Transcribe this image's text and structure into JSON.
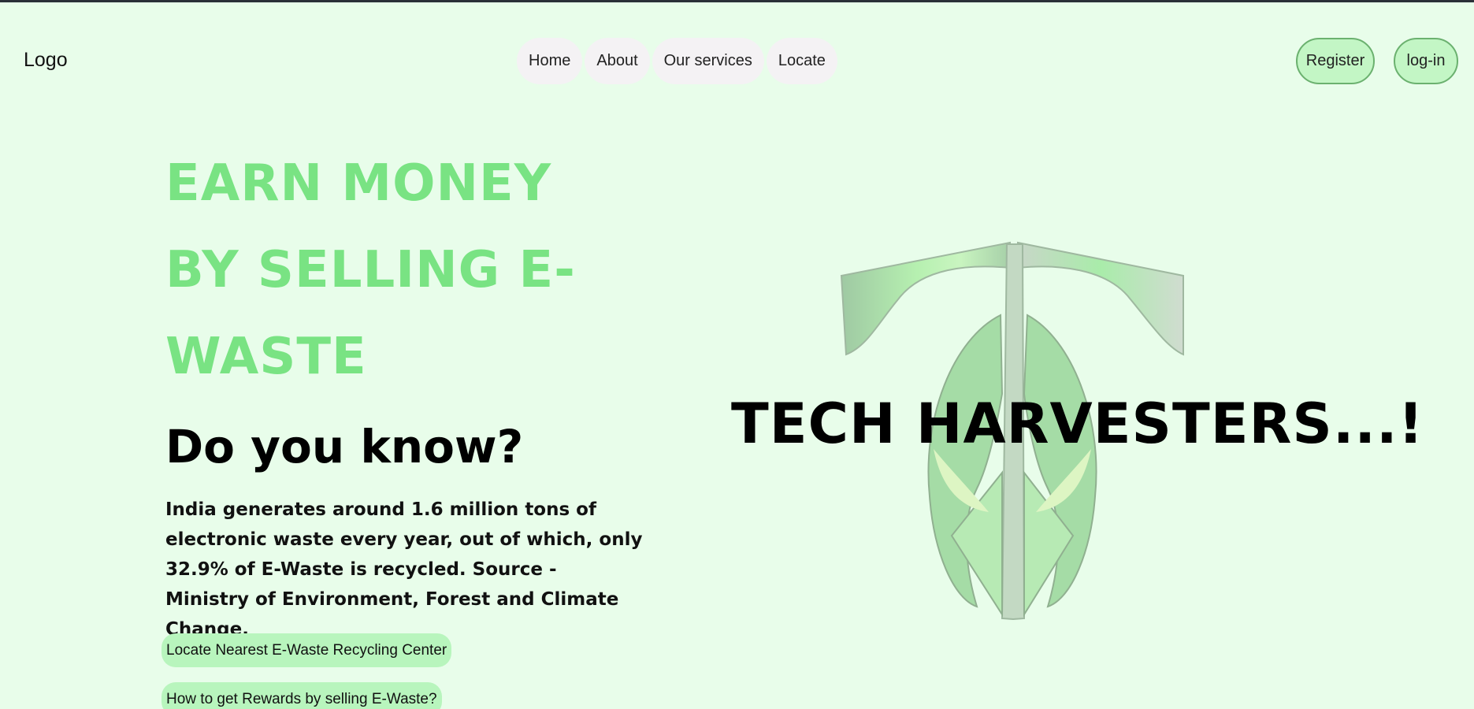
{
  "header": {
    "logo": "Logo",
    "nav": [
      "Home",
      "About",
      "Our services",
      "Locate"
    ],
    "register": "Register",
    "login": "log-in"
  },
  "hero": {
    "headline": "EARN MONEY BY SELLING E-WASTE",
    "subheading": "Do you know?",
    "fact": "India generates around 1.6 million tons of electronic waste every year, out of which, only 32.9% of E-Waste is recycled. Source - Ministry of Environment, Forest and Climate Change.",
    "cta_locate": "Locate Nearest E-Waste Recycling Center",
    "cta_rewards": "How to get Rewards by selling E-Waste?",
    "brand_title": "TECH HARVESTERS...!"
  },
  "colors": {
    "background": "#e8fdea",
    "headline": "#79e383",
    "button_fill": "#c3f6c5"
  },
  "icons": {
    "emblem": "th-emblem-icon"
  }
}
